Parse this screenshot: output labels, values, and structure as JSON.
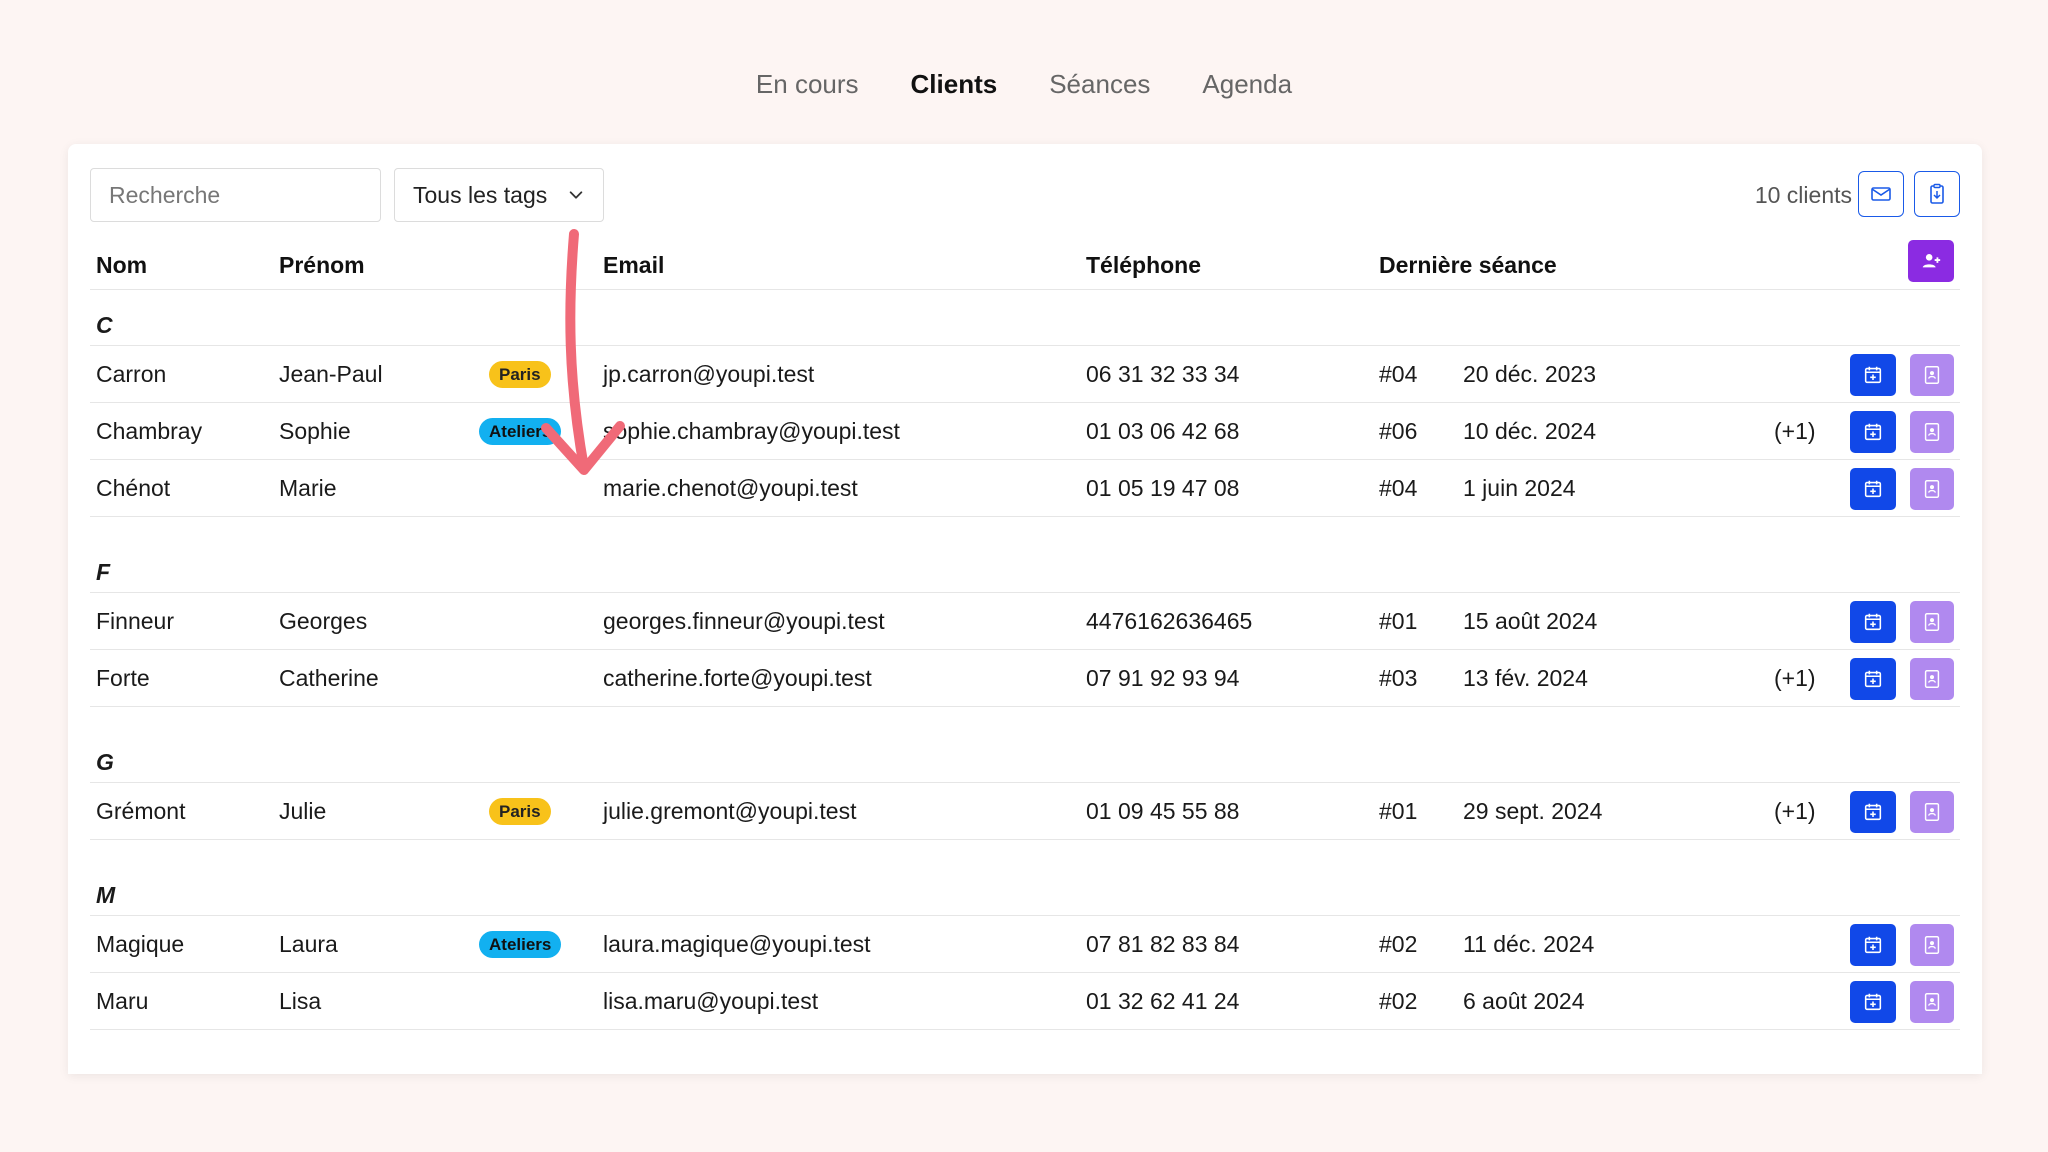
{
  "nav": {
    "tabs": [
      {
        "label": "En cours",
        "active": false
      },
      {
        "label": "Clients",
        "active": true
      },
      {
        "label": "Séances",
        "active": false
      },
      {
        "label": "Agenda",
        "active": false
      }
    ]
  },
  "toolbar": {
    "search_placeholder": "Recherche",
    "tag_filter_value": "Tous les tags",
    "client_count": "10 clients",
    "email_icon": "mail-icon",
    "export_icon": "clipboard-icon"
  },
  "table": {
    "headers": {
      "nom": "Nom",
      "prenom": "Prénom",
      "email": "Email",
      "telephone": "Téléphone",
      "derniere": "Dernière séance"
    },
    "groups": [
      {
        "letter": "C",
        "rows": [
          {
            "nom": "Carron",
            "prenom": "Jean-Paul",
            "tag": "Paris",
            "email": "jp.carron@youpi.test",
            "tel": "06 31 32 33 34",
            "num": "#04",
            "date": "20 déc. 2023",
            "extra": ""
          },
          {
            "nom": "Chambray",
            "prenom": "Sophie",
            "tag": "Ateliers",
            "email": "sophie.chambray@youpi.test",
            "tel": "01 03 06 42 68",
            "num": "#06",
            "date": "10 déc. 2024",
            "extra": "(+1)"
          },
          {
            "nom": "Chénot",
            "prenom": "Marie",
            "tag": "",
            "email": "marie.chenot@youpi.test",
            "tel": "01 05 19 47 08",
            "num": "#04",
            "date": "1 juin 2024",
            "extra": ""
          }
        ]
      },
      {
        "letter": "F",
        "rows": [
          {
            "nom": "Finneur",
            "prenom": "Georges",
            "tag": "",
            "email": "georges.finneur@youpi.test",
            "tel": "4476162636465",
            "num": "#01",
            "date": "15 août 2024",
            "extra": ""
          },
          {
            "nom": "Forte",
            "prenom": "Catherine",
            "tag": "",
            "email": "catherine.forte@youpi.test",
            "tel": "07 91 92 93 94",
            "num": "#03",
            "date": "13 fév. 2024",
            "extra": "(+1)"
          }
        ]
      },
      {
        "letter": "G",
        "rows": [
          {
            "nom": "Grémont",
            "prenom": "Julie",
            "tag": "Paris",
            "email": "julie.gremont@youpi.test",
            "tel": "01 09 45 55 88",
            "num": "#01",
            "date": "29 sept. 2024",
            "extra": "(+1)"
          }
        ]
      },
      {
        "letter": "M",
        "rows": [
          {
            "nom": "Magique",
            "prenom": "Laura",
            "tag": "Ateliers",
            "email": "laura.magique@youpi.test",
            "tel": "07 81 82 83 84",
            "num": "#02",
            "date": "11 déc. 2024",
            "extra": ""
          },
          {
            "nom": "Maru",
            "prenom": "Lisa",
            "tag": "",
            "email": "lisa.maru@youpi.test",
            "tel": "01 32 62 41 24",
            "num": "#02",
            "date": "6 août 2024",
            "extra": ""
          }
        ]
      }
    ]
  },
  "colors": {
    "background": "#fdf5f3",
    "primary_blue": "#1148e8",
    "purple": "#8b2be2",
    "light_purple": "#b089ef",
    "tag_paris": "#f8c21a",
    "tag_ateliers": "#12b0f0",
    "annotation_arrow": "#f06a78"
  }
}
